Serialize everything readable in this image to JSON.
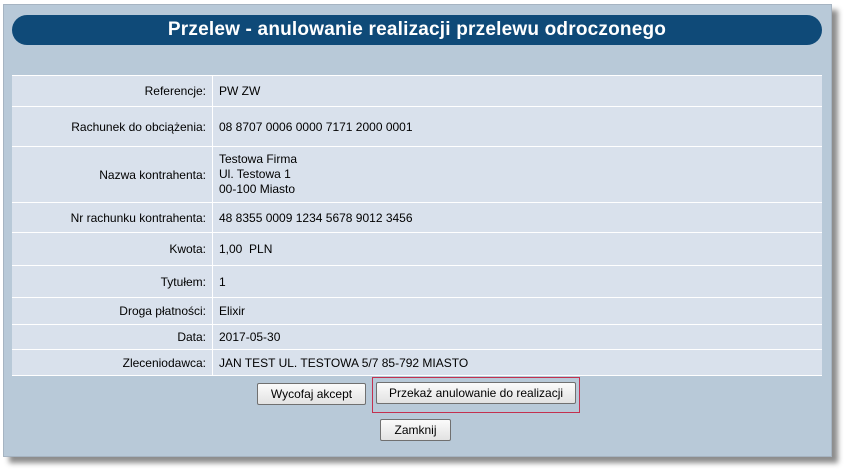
{
  "header": {
    "title": "Przelew - anulowanie realizacji przelewu odroczonego"
  },
  "details": [
    {
      "label": "Referencje:",
      "value": "PW ZW"
    },
    {
      "label": "Rachunek do obciążenia:",
      "value": "08 8707 0006 0000 7171 2000 0001"
    },
    {
      "label": "Nazwa kontrahenta:",
      "lines": [
        "Testowa Firma",
        "Ul. Testowa 1",
        "00-100 Miasto"
      ]
    },
    {
      "label": "Nr rachunku kontrahenta:",
      "value": "48 8355 0009 1234 5678 9012 3456"
    },
    {
      "label": "Kwota:",
      "value": "1,00  PLN"
    },
    {
      "label": "Tytułem:",
      "value": "1"
    },
    {
      "label": "Droga płatności:",
      "value": "Elixir"
    },
    {
      "label": "Data:",
      "value": "2017-05-30"
    },
    {
      "label": "Zleceniodawca:",
      "value": "JAN TEST UL. TESTOWA 5/7 85-792 MIASTO"
    }
  ],
  "actions": {
    "withdraw_label": "Wycofaj akcept",
    "submit_label": "Przekaż anulowanie do realizacji",
    "close_label": "Zamknij"
  },
  "colors": {
    "title_bar": "#0f4a78",
    "panel_bg": "#b8c9d8",
    "table_bg": "#d9e1ec",
    "focus_outline": "#c3304f"
  }
}
